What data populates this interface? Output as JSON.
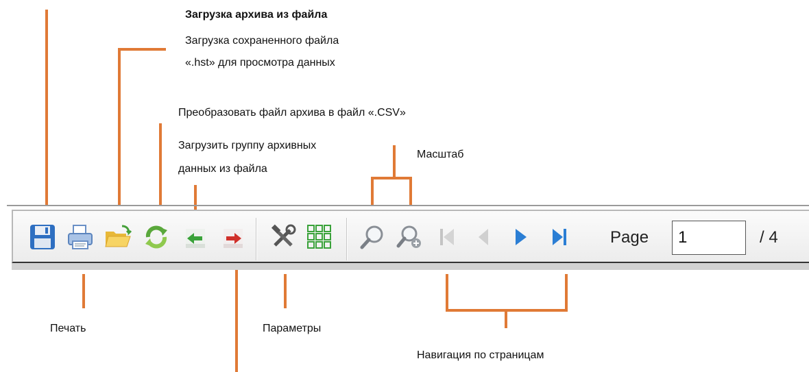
{
  "annotations": {
    "load_archive_title": "Загрузка архива из файла",
    "load_archive_desc_line1": "Загрузка сохраненного файла",
    "load_archive_desc_line2": "«.hst» для просмотра данных",
    "convert_csv": "Преобразовать файл архива в файл «.CSV»",
    "load_group_line1": "Загрузить группу архивных",
    "load_group_line2": "данных  из файла",
    "zoom": "Масштаб",
    "print": "Печать",
    "settings": "Параметры",
    "page_navigation": "Навигация по страницам"
  },
  "toolbar": {
    "page_label": "Page",
    "page_value": "1",
    "page_total": "/ 4",
    "icons": [
      "save-icon",
      "print-icon",
      "open-folder-icon",
      "convert-icon",
      "import-icon",
      "export-icon",
      "tools-icon",
      "grid-icon",
      "zoom-icon",
      "zoom-in-icon",
      "first-page-icon",
      "prev-page-icon",
      "next-page-icon",
      "last-page-icon"
    ]
  },
  "colors": {
    "callout": "#e07a36",
    "nav_active": "#2b7ed4",
    "nav_disabled": "#c4c4c4"
  }
}
